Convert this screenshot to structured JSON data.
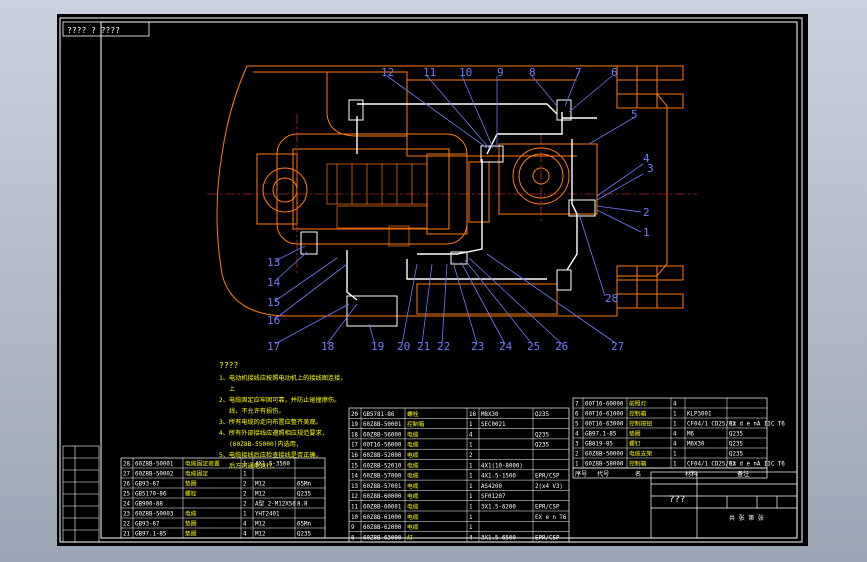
{
  "title_tag": "???? ? ????",
  "callouts": [
    "1",
    "2",
    "3",
    "4",
    "5",
    "6",
    "7",
    "8",
    "9",
    "10",
    "11",
    "12",
    "13",
    "14",
    "15",
    "16",
    "17",
    "18",
    "19",
    "20",
    "21",
    "22",
    "23",
    "24",
    "25",
    "26",
    "27",
    "28"
  ],
  "notes": {
    "heading": "????",
    "lines": [
      "1、电动机接线应按照电动机上的接线图连接，",
      "上",
      "2、电缆固定应牢固可靠，并防止碰撞擦伤。",
      "线，不允许有损伤。",
      "3、所有电缆的走向布置应整齐美观。",
      "4、所有外部接线应遵照相应规范要求，",
      "(60Z8B-55000)内选用，",
      "5、电缆接线后应检查接线是否正确，",
      "后方可通电运行。"
    ]
  },
  "bom_left": [
    {
      "no": "28",
      "code": "60Z8B-50001",
      "name": "电缆固定装置",
      "qty": "1",
      "spec": "4X1.5-3500",
      "note": ""
    },
    {
      "no": "27",
      "code": "60Z8B-50002",
      "name": "电缆固定",
      "qty": "1",
      "spec": "",
      "note": ""
    },
    {
      "no": "26",
      "code": "GB93-87",
      "name": "垫圈",
      "qty": "2",
      "spec": "M12",
      "note": "65Mn"
    },
    {
      "no": "25",
      "code": "GB5170-86",
      "name": "螺栓",
      "qty": "2",
      "spec": "M12",
      "note": "Q235"
    },
    {
      "no": "24",
      "code": "GB900-88",
      "name": "",
      "qty": "2",
      "spec": "A型 2-M12X50",
      "note": "8.8"
    },
    {
      "no": "23",
      "code": "60Z8B-50003",
      "name": "电缆",
      "qty": "1",
      "spec": "YHT2401",
      "note": ""
    },
    {
      "no": "22",
      "code": "GB93-87",
      "name": "垫圈",
      "qty": "4",
      "spec": "M12",
      "note": "65Mn"
    },
    {
      "no": "21",
      "code": "GB97.1-85",
      "name": "垫圈",
      "qty": "4",
      "spec": "M12",
      "note": "Q235"
    }
  ],
  "bom_mid": [
    {
      "no": "20",
      "code": "GB5781-86",
      "name": "螺栓",
      "qty": "16",
      "spec": "M8X30",
      "note": "Q235"
    },
    {
      "no": "19",
      "code": "60Z8B-50001",
      "name": "控制箱",
      "qty": "1",
      "spec": "SEC0021",
      "note": ""
    },
    {
      "no": "18",
      "code": "60Z8B-56000",
      "name": "电缆",
      "qty": "4",
      "spec": "",
      "note": "Q235"
    },
    {
      "no": "17",
      "code": "00T16-56000",
      "name": "电缆",
      "qty": "1",
      "spec": "",
      "note": "Q235"
    },
    {
      "no": "16",
      "code": "60Z8B-52000",
      "name": "电缆",
      "qty": "2",
      "spec": "",
      "note": ""
    },
    {
      "no": "15",
      "code": "60Z8B-52010",
      "name": "电缆",
      "qty": "1",
      "spec": "4X1(10-8000)",
      "note": ""
    },
    {
      "no": "14",
      "code": "60Z8B-57000",
      "name": "电缆",
      "qty": "1",
      "spec": "4X1.5-1500",
      "note": "EPR/CSP"
    },
    {
      "no": "13",
      "code": "60Z8B-57001",
      "name": "电缆",
      "qty": "1",
      "spec": "AS4200",
      "note": "2(x4 V3)"
    },
    {
      "no": "12",
      "code": "60Z8B-60000",
      "name": "电缆",
      "qty": "1",
      "spec": "SF01207",
      "note": ""
    },
    {
      "no": "11",
      "code": "60Z8B-60001",
      "name": "电缆",
      "qty": "1",
      "spec": "3X1.5-6200",
      "note": "EPR/CSP"
    },
    {
      "no": "10",
      "code": "60Z8B-61000",
      "name": "电缆",
      "qty": "1",
      "spec": "",
      "note": "EX e n T6"
    },
    {
      "no": "9",
      "code": "60Z8B-62000",
      "name": "电缆",
      "qty": "1",
      "spec": "",
      "note": ""
    },
    {
      "no": "8",
      "code": "60Z8B-63000",
      "name": "灯",
      "qty": "4",
      "spec": "3X1.5-6500",
      "note": "EPR/CSP"
    }
  ],
  "bom_right": [
    {
      "no": "7",
      "code": "00T16-60000",
      "name": "前照灯",
      "qty": "4",
      "spec": "",
      "note": ""
    },
    {
      "no": "6",
      "code": "00T16-61000",
      "name": "控制箱",
      "qty": "1",
      "spec": "KLP3001",
      "note": ""
    },
    {
      "no": "5",
      "code": "00T16-63000",
      "name": "控制按钮",
      "qty": "1",
      "spec": "CF04/1 CD25/03",
      "note": "Ex d e nA IIC T6"
    },
    {
      "no": "4",
      "code": "GB97.1-85",
      "name": "垫圈",
      "qty": "4",
      "spec": "M6",
      "note": "Q235"
    },
    {
      "no": "3",
      "code": "GB819-85",
      "name": "螺钉",
      "qty": "4",
      "spec": "M6X30",
      "note": "Q235"
    },
    {
      "no": "2",
      "code": "60Z8B-50000",
      "name": "电缆支架",
      "qty": "1",
      "spec": "",
      "note": "Q235"
    },
    {
      "no": "1",
      "code": "60Z8B-58000",
      "name": "控制箱",
      "qty": "1",
      "spec": "CF04/1 CD25/03",
      "note": "Ex d e nA IIC T6"
    }
  ],
  "bom_header": {
    "no": "序号",
    "code": "代号",
    "name": "名",
    "spec": "材料",
    "note": "备注"
  },
  "title_block": {
    "drawing_title": "???",
    "material_label": "材料",
    "remark_label": "备注",
    "sheet_label": "共 张 第 张"
  },
  "colors": {
    "frame": "#ffffff",
    "outline": "#ff7a10",
    "cable": "#ffffff",
    "centerline": "#ff3a3a",
    "callout": "#6c7cff",
    "leader": "#6c7cff",
    "note_text": "#ffff00",
    "table_line": "#ffffff"
  }
}
